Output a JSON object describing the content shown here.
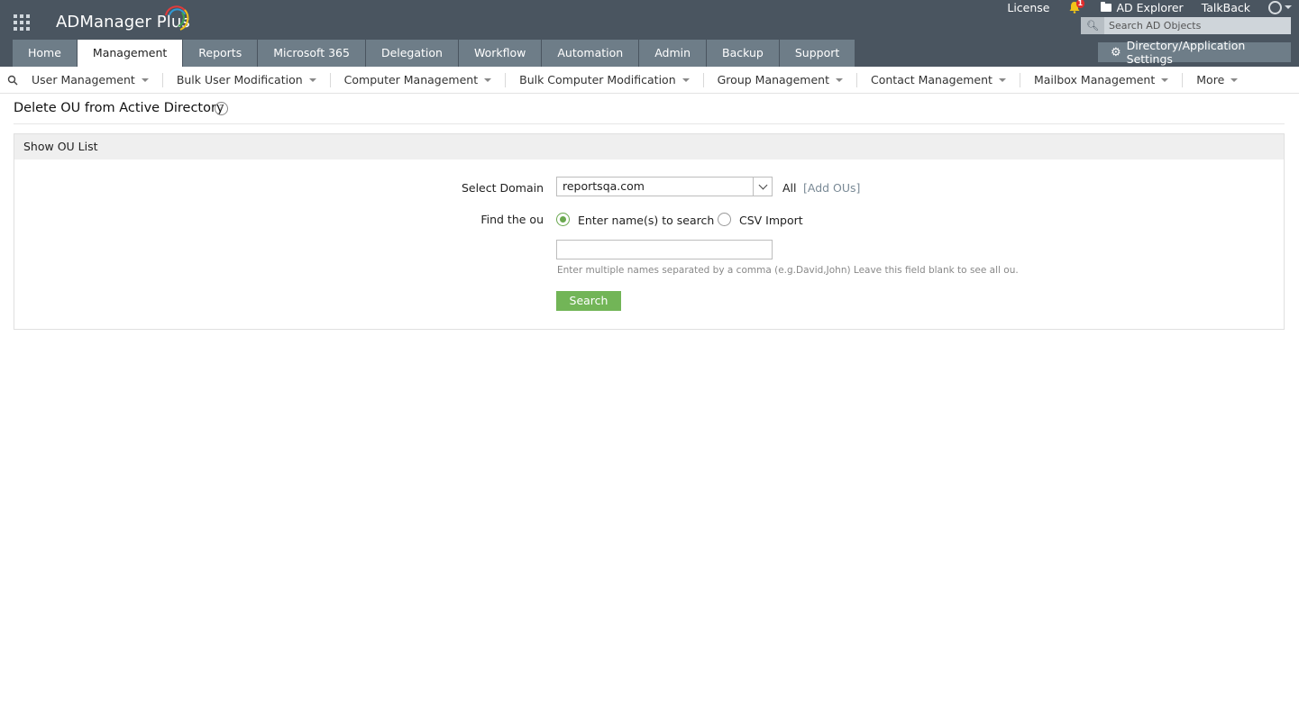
{
  "header": {
    "logo_text": "ADManager Plus",
    "links": {
      "license": "License",
      "notification_count": "1",
      "ad_explorer": "AD Explorer",
      "talkback": "TalkBack"
    },
    "search_placeholder": "Search AD Objects",
    "settings_label": "Directory/Application Settings"
  },
  "tabs": [
    {
      "label": "Home"
    },
    {
      "label": "Management"
    },
    {
      "label": "Reports"
    },
    {
      "label": "Microsoft 365"
    },
    {
      "label": "Delegation"
    },
    {
      "label": "Workflow"
    },
    {
      "label": "Automation"
    },
    {
      "label": "Admin"
    },
    {
      "label": "Backup"
    },
    {
      "label": "Support"
    }
  ],
  "active_tab": "Management",
  "subnav": [
    {
      "label": "User Management"
    },
    {
      "label": "Bulk User Modification"
    },
    {
      "label": "Computer Management"
    },
    {
      "label": "Bulk Computer Modification"
    },
    {
      "label": "Group Management"
    },
    {
      "label": "Contact Management"
    },
    {
      "label": "Mailbox Management"
    },
    {
      "label": "More"
    }
  ],
  "page": {
    "title": "Delete OU from Active Directory",
    "help": "?",
    "panel_title": "Show OU List"
  },
  "form": {
    "domain_label": "Select Domain",
    "domain_value": "reportsqa.com",
    "all_text": "All",
    "add_ous": "[Add OUs]",
    "find_label": "Find the ou",
    "option_names": "Enter name(s) to search",
    "option_csv": "CSV Import",
    "selected_option": "names",
    "names_value": "",
    "hint": "Enter multiple names separated by a comma (e.g.David,John) Leave this field blank to see all ou.",
    "search_button": "Search"
  },
  "colors": {
    "header_bg": "#4a5560",
    "tab_bg": "#6e7d88",
    "accent_green": "#72b557",
    "badge_red": "#e02d2d"
  }
}
